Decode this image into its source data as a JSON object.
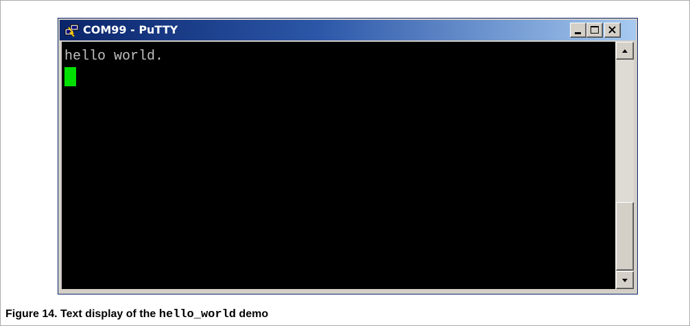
{
  "window": {
    "title": "COM99 - PuTTY",
    "icon": "putty-icon",
    "buttons": [
      "minimize-icon",
      "maximize-icon",
      "close-icon"
    ]
  },
  "terminal": {
    "lines": [
      "hello world."
    ],
    "cursor_color": "#00e000",
    "background": "#000000",
    "text_color": "#c0c0c0"
  },
  "caption": {
    "prefix": "Figure 14.  Text display of the ",
    "code": "hello_world",
    "suffix": " demo"
  }
}
